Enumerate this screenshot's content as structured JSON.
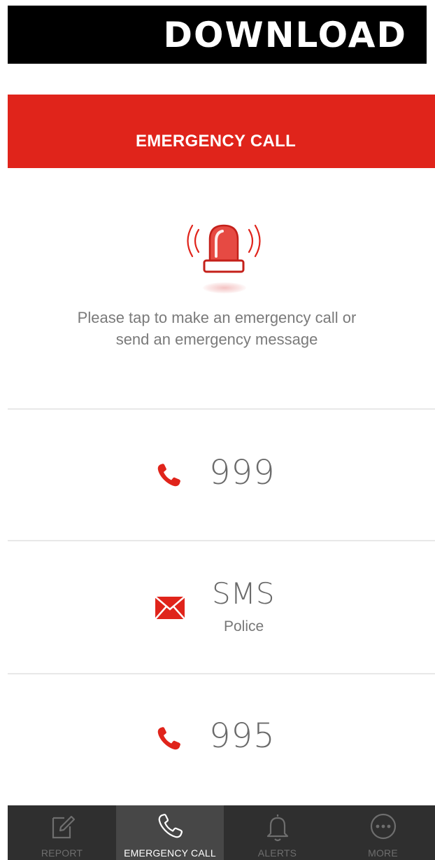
{
  "banner": {
    "text": "DOWNLOAD"
  },
  "header": {
    "title": "EMERGENCY CALL"
  },
  "hero": {
    "icon": "siren-icon",
    "instruction_line1": "Please tap to make an emergency call or",
    "instruction_line2": "send an emergency message"
  },
  "options": [
    {
      "icon": "phone-icon",
      "label": "999"
    },
    {
      "icon": "envelope-icon",
      "label": "SMS",
      "sublabel": "Police"
    },
    {
      "icon": "phone-icon",
      "label": "995"
    }
  ],
  "tabs": [
    {
      "icon": "pencil-note-icon",
      "label": "REPORT",
      "active": false
    },
    {
      "icon": "phone-icon",
      "label": "EMERGENCY CALL",
      "active": true
    },
    {
      "icon": "bell-icon",
      "label": "ALERTS",
      "active": false
    },
    {
      "icon": "more-dots-icon",
      "label": "MORE",
      "active": false
    }
  ],
  "colors": {
    "accent": "#e0241b",
    "tab_bar": "#2f2f2f",
    "tab_active": "#474747"
  }
}
